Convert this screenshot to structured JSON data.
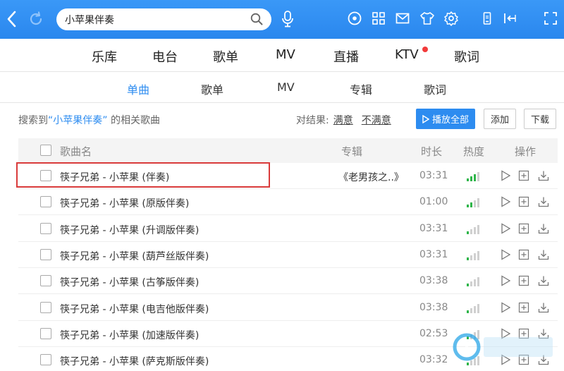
{
  "search": {
    "value": "小苹果伴奏"
  },
  "nav": [
    "乐库",
    "电台",
    "歌单",
    "MV",
    "直播",
    "KTV",
    "歌词"
  ],
  "subtabs": [
    "单曲",
    "歌单",
    "MV",
    "专辑",
    "歌词"
  ],
  "active_subtab": "单曲",
  "result": {
    "prefix": "搜索到",
    "keyword": "“小苹果伴奏”",
    "suffix": "的相关歌曲"
  },
  "feedback": {
    "label": "对结果:",
    "good": "满意",
    "bad": "不满意"
  },
  "actions": {
    "play_all": "播放全部",
    "add": "添加",
    "download": "下载"
  },
  "columns": {
    "name": "歌曲名",
    "album": "专辑",
    "duration": "时长",
    "heat": "热度",
    "ops": "操作"
  },
  "songs": [
    {
      "name": "筷子兄弟 - 小苹果 (伴奏)",
      "album": "《老男孩之..》",
      "duration": "03:31",
      "heat": 3
    },
    {
      "name": "筷子兄弟 - 小苹果 (原版伴奏)",
      "album": "",
      "duration": "01:00",
      "heat": 2
    },
    {
      "name": "筷子兄弟 - 小苹果 (升调版伴奏)",
      "album": "",
      "duration": "03:31",
      "heat": 1
    },
    {
      "name": "筷子兄弟 - 小苹果 (葫芦丝版伴奏)",
      "album": "",
      "duration": "03:31",
      "heat": 1
    },
    {
      "name": "筷子兄弟 - 小苹果 (古筝版伴奏)",
      "album": "",
      "duration": "03:38",
      "heat": 1
    },
    {
      "name": "筷子兄弟 - 小苹果 (电吉他版伴奏)",
      "album": "",
      "duration": "03:38",
      "heat": 1
    },
    {
      "name": "筷子兄弟 - 小苹果 (加速版伴奏)",
      "album": "",
      "duration": "02:53",
      "heat": 1
    },
    {
      "name": "筷子兄弟 - 小苹果 (萨克斯版伴奏)",
      "album": "",
      "duration": "03:32",
      "heat": 1
    }
  ],
  "colors": {
    "brand": "#2d8cf0",
    "heat_on": "#2fb54a",
    "heat_off": "#d0d0d0",
    "highlight": "#d93b3b"
  },
  "icons": [
    "back-icon",
    "refresh-icon",
    "search-icon",
    "mic-icon",
    "record-icon",
    "apps-icon",
    "mail-icon",
    "skin-icon",
    "settings-icon",
    "phone-icon",
    "mini-mode-icon",
    "expand-icon"
  ]
}
